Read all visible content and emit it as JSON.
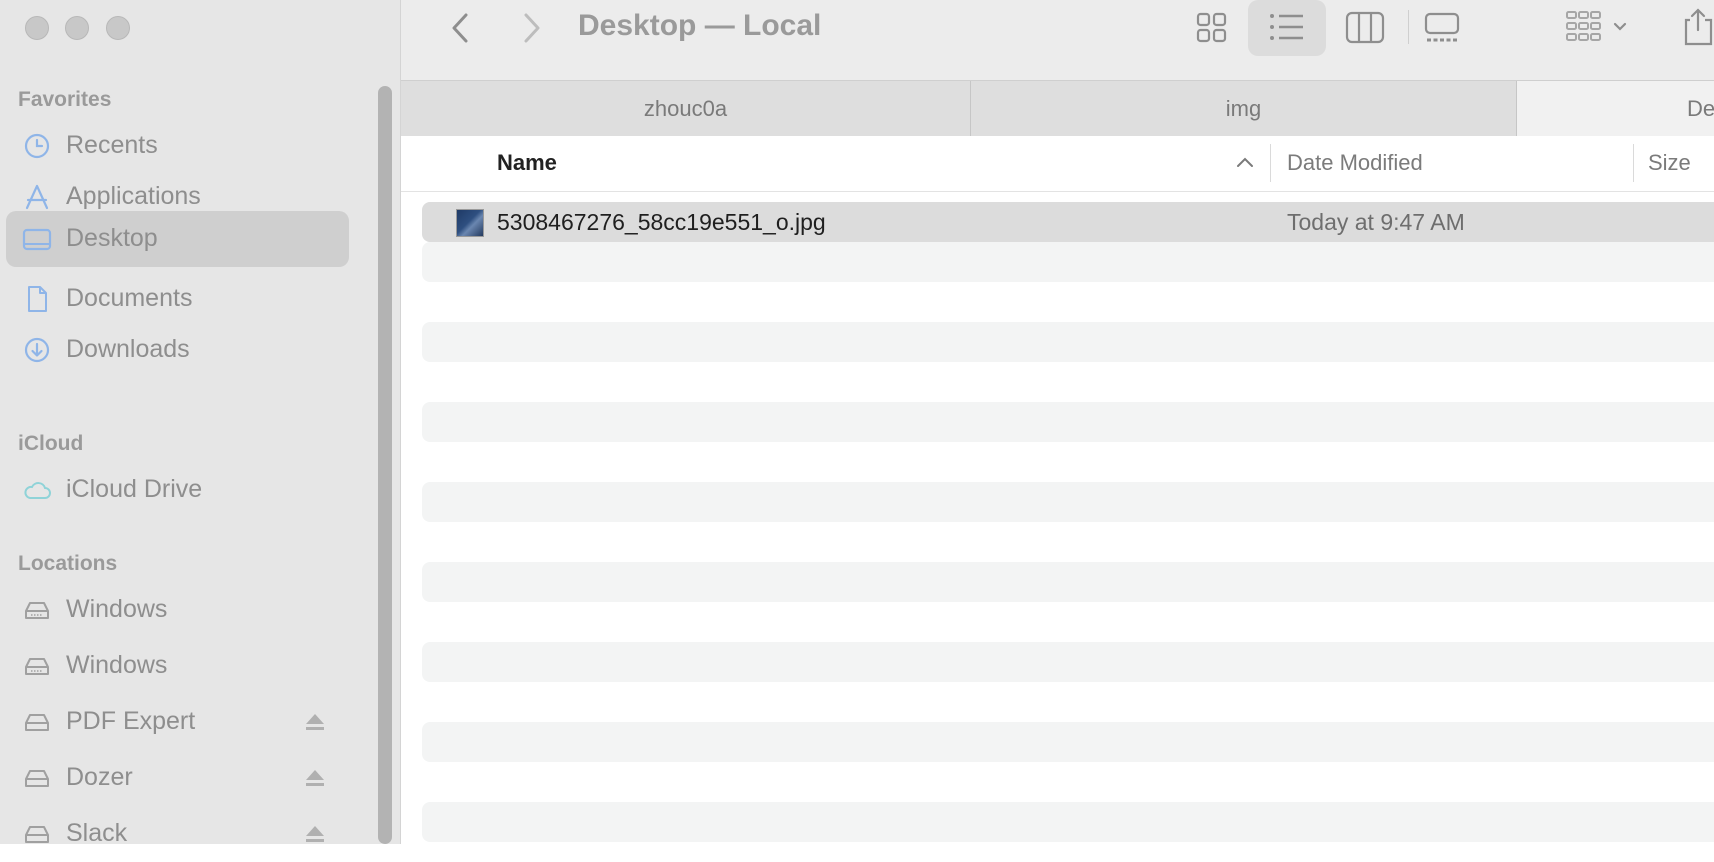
{
  "window": {
    "title": "Desktop — Local"
  },
  "sidebar": {
    "sections": [
      {
        "title": "Favorites",
        "items": [
          {
            "label": "Recents",
            "icon": "clock-icon"
          },
          {
            "label": "Applications",
            "icon": "apps-icon"
          },
          {
            "label": "Desktop",
            "icon": "desktop-icon",
            "selected": true
          },
          {
            "label": "Documents",
            "icon": "document-icon"
          },
          {
            "label": "Downloads",
            "icon": "download-icon"
          }
        ]
      },
      {
        "title": "iCloud",
        "items": [
          {
            "label": "iCloud Drive",
            "icon": "cloud-icon"
          }
        ]
      },
      {
        "title": "Locations",
        "items": [
          {
            "label": "Windows",
            "icon": "drive-icon"
          },
          {
            "label": "Windows",
            "icon": "drive-icon"
          },
          {
            "label": "PDF Expert",
            "icon": "drive-icon",
            "ejectable": true
          },
          {
            "label": "Dozer",
            "icon": "drive-icon",
            "ejectable": true
          },
          {
            "label": "Slack",
            "icon": "drive-icon",
            "ejectable": true
          }
        ]
      }
    ]
  },
  "path_tabs": [
    "zhouc0a",
    "img",
    "De"
  ],
  "columns": {
    "name": "Name",
    "date": "Date Modified",
    "size": "Size"
  },
  "files": [
    {
      "name": "5308467276_58cc19e551_o.jpg",
      "date": "Today at 9:47 AM",
      "selected": true
    }
  ],
  "colors": {
    "accent_icon": "#8fb5e8",
    "selection": "#dcdcdc",
    "sidebar_bg": "#e6e6e6"
  }
}
